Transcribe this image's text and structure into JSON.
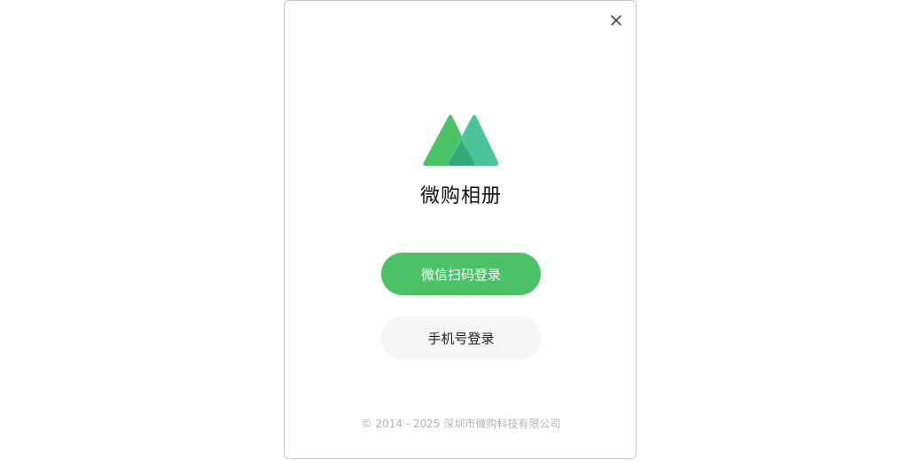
{
  "dialog": {
    "app_name": "微购相册",
    "close_icon": "close-icon",
    "logo_icon": "twin-triangle-logo-icon",
    "buttons": {
      "wechat_scan_label": "微信扫码登录",
      "phone_label": "手机号登录"
    },
    "copyright": "© 2014 - 2025 深圳市微购科技有限公司"
  },
  "colors": {
    "primary_green": "#4cc266",
    "logo_left": "#4cc266",
    "logo_right": "#4cc49a",
    "logo_overlap": "#33aa78",
    "secondary_button_bg": "#f6f6f8",
    "copyright_text": "#b3b3b3"
  }
}
